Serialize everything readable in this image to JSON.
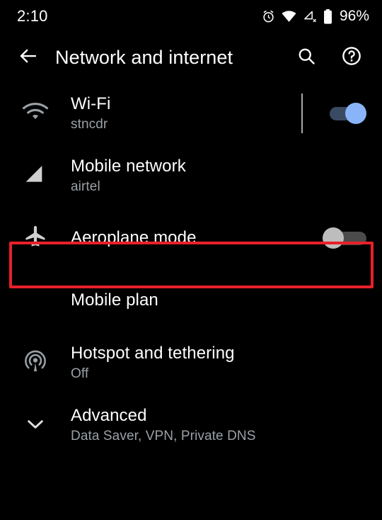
{
  "status_bar": {
    "time": "2:10",
    "battery_percent": "96%",
    "icons": [
      "alarm-icon",
      "wifi-icon",
      "mobile-signal-off-icon",
      "battery-icon"
    ]
  },
  "app_bar": {
    "back_icon": "back-arrow-icon",
    "title": "Network and internet",
    "search_icon": "search-icon",
    "help_icon": "help-circle-icon"
  },
  "settings": {
    "rows": [
      {
        "id": "wifi",
        "icon": "wifi-icon",
        "title": "Wi-Fi",
        "subtitle": "stncdr",
        "has_divider": true,
        "toggle": "on"
      },
      {
        "id": "mobile-network",
        "icon": "mobile-signal-icon",
        "title": "Mobile network",
        "subtitle": "airtel",
        "has_divider": false,
        "toggle": null
      },
      {
        "id": "aeroplane-mode",
        "icon": "airplane-icon",
        "title": "Aeroplane mode",
        "subtitle": "",
        "has_divider": false,
        "toggle": "off",
        "highlighted": true
      },
      {
        "id": "mobile-plan",
        "icon": "",
        "title": "Mobile plan",
        "subtitle": "",
        "has_divider": false,
        "toggle": null
      },
      {
        "id": "hotspot-and-tethering",
        "icon": "hotspot-icon",
        "title": "Hotspot and tethering",
        "subtitle": "Off",
        "has_divider": false,
        "toggle": null
      },
      {
        "id": "advanced",
        "icon": "chevron-down-icon",
        "title": "Advanced",
        "subtitle": "Data Saver, VPN, Private DNS",
        "has_divider": false,
        "toggle": null
      }
    ]
  },
  "colors": {
    "background": "#000000",
    "primary_text": "#ffffff",
    "secondary_text": "#9aa0a6",
    "icon": "#9aa0a6",
    "toggle_on_thumb": "#8ab4f8",
    "toggle_on_track": "#3b4a63",
    "toggle_off_thumb": "#bdbdbd",
    "toggle_off_track": "#4b4b4b",
    "highlight_border": "#e8202a"
  }
}
